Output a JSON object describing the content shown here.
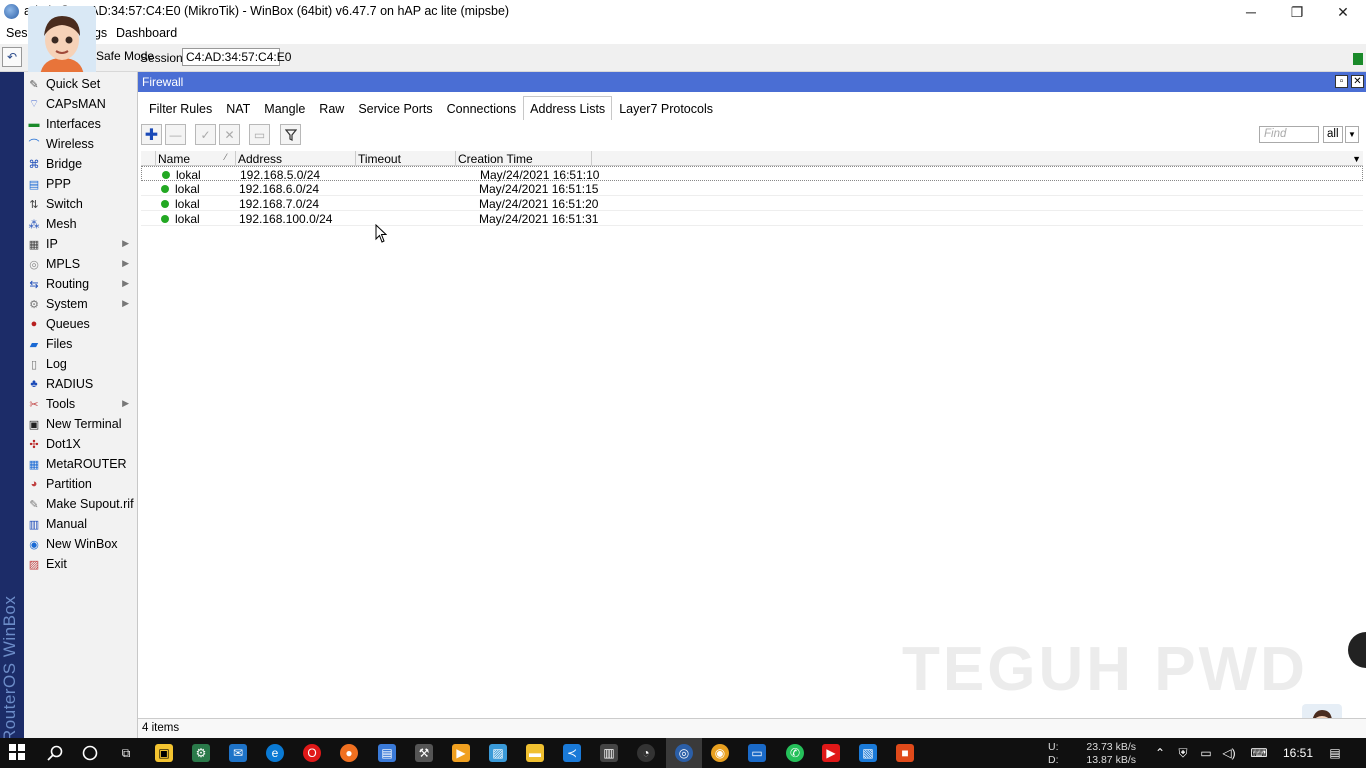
{
  "window": {
    "title": "admin@C4:AD:34:57:C4:E0 (MikroTik) - WinBox (64bit) v6.47.7 on hAP ac lite (mipsbe)",
    "minimize": "─",
    "restore": "❐",
    "close": "✕"
  },
  "menu": {
    "session": "Session",
    "settings": "Settings",
    "dashboard": "Dashboard"
  },
  "toolbar": {
    "undo": "↶",
    "safe_mode": "Safe Mode",
    "session_label": "Session:",
    "session_value": "C4:AD:34:57:C4:E0"
  },
  "brand": "RouterOS WinBox",
  "sidebar": {
    "items": [
      {
        "label": "Quick Set",
        "icon": "quick-set-icon",
        "sub": false
      },
      {
        "label": "CAPsMAN",
        "icon": "capsman-icon",
        "sub": false
      },
      {
        "label": "Interfaces",
        "icon": "interfaces-icon",
        "sub": false
      },
      {
        "label": "Wireless",
        "icon": "wireless-icon",
        "sub": false
      },
      {
        "label": "Bridge",
        "icon": "bridge-icon",
        "sub": false
      },
      {
        "label": "PPP",
        "icon": "ppp-icon",
        "sub": false
      },
      {
        "label": "Switch",
        "icon": "switch-icon",
        "sub": false
      },
      {
        "label": "Mesh",
        "icon": "mesh-icon",
        "sub": false
      },
      {
        "label": "IP",
        "icon": "ip-icon",
        "sub": true
      },
      {
        "label": "MPLS",
        "icon": "mpls-icon",
        "sub": true
      },
      {
        "label": "Routing",
        "icon": "routing-icon",
        "sub": true
      },
      {
        "label": "System",
        "icon": "system-icon",
        "sub": true
      },
      {
        "label": "Queues",
        "icon": "queues-icon",
        "sub": false
      },
      {
        "label": "Files",
        "icon": "files-icon",
        "sub": false
      },
      {
        "label": "Log",
        "icon": "log-icon",
        "sub": false
      },
      {
        "label": "RADIUS",
        "icon": "radius-icon",
        "sub": false
      },
      {
        "label": "Tools",
        "icon": "tools-icon",
        "sub": true
      },
      {
        "label": "New Terminal",
        "icon": "terminal-icon",
        "sub": false
      },
      {
        "label": "Dot1X",
        "icon": "dot1x-icon",
        "sub": false
      },
      {
        "label": "MetaROUTER",
        "icon": "metarouter-icon",
        "sub": false
      },
      {
        "label": "Partition",
        "icon": "partition-icon",
        "sub": false
      },
      {
        "label": "Make Supout.rif",
        "icon": "supout-icon",
        "sub": false
      },
      {
        "label": "Manual",
        "icon": "manual-icon",
        "sub": false
      },
      {
        "label": "New WinBox",
        "icon": "winbox-icon",
        "sub": false
      },
      {
        "label": "Exit",
        "icon": "exit-icon",
        "sub": false
      }
    ],
    "submenu_arrow": "▶"
  },
  "firewall": {
    "title": "Firewall",
    "tabs": [
      "Filter Rules",
      "NAT",
      "Mangle",
      "Raw",
      "Service Ports",
      "Connections",
      "Address Lists",
      "Layer7 Protocols"
    ],
    "active_tab": "Address Lists",
    "find_placeholder": "Find",
    "filter_all": "all",
    "columns": [
      "Name",
      "Address",
      "Timeout",
      "Creation Time"
    ],
    "rows": [
      {
        "name": "lokal",
        "address": "192.168.5.0/24",
        "timeout": "",
        "created": "May/24/2021 16:51:10"
      },
      {
        "name": "lokal",
        "address": "192.168.6.0/24",
        "timeout": "",
        "created": "May/24/2021 16:51:15"
      },
      {
        "name": "lokal",
        "address": "192.168.7.0/24",
        "timeout": "",
        "created": "May/24/2021 16:51:20"
      },
      {
        "name": "lokal",
        "address": "192.168.100.0/24",
        "timeout": "",
        "created": "May/24/2021 16:51:31"
      }
    ],
    "status": "4 items",
    "watermark": "TEGUH PWD"
  },
  "taskbar": {
    "up_label": "U:",
    "down_label": "D:",
    "up_value": "23.73 kB/s",
    "down_value": "13.87 kB/s",
    "time": "16:51"
  },
  "colors": {
    "title_blue": "#4a6ed4",
    "brand_bar": "#1c2c68",
    "enabled_green": "#22a822"
  }
}
